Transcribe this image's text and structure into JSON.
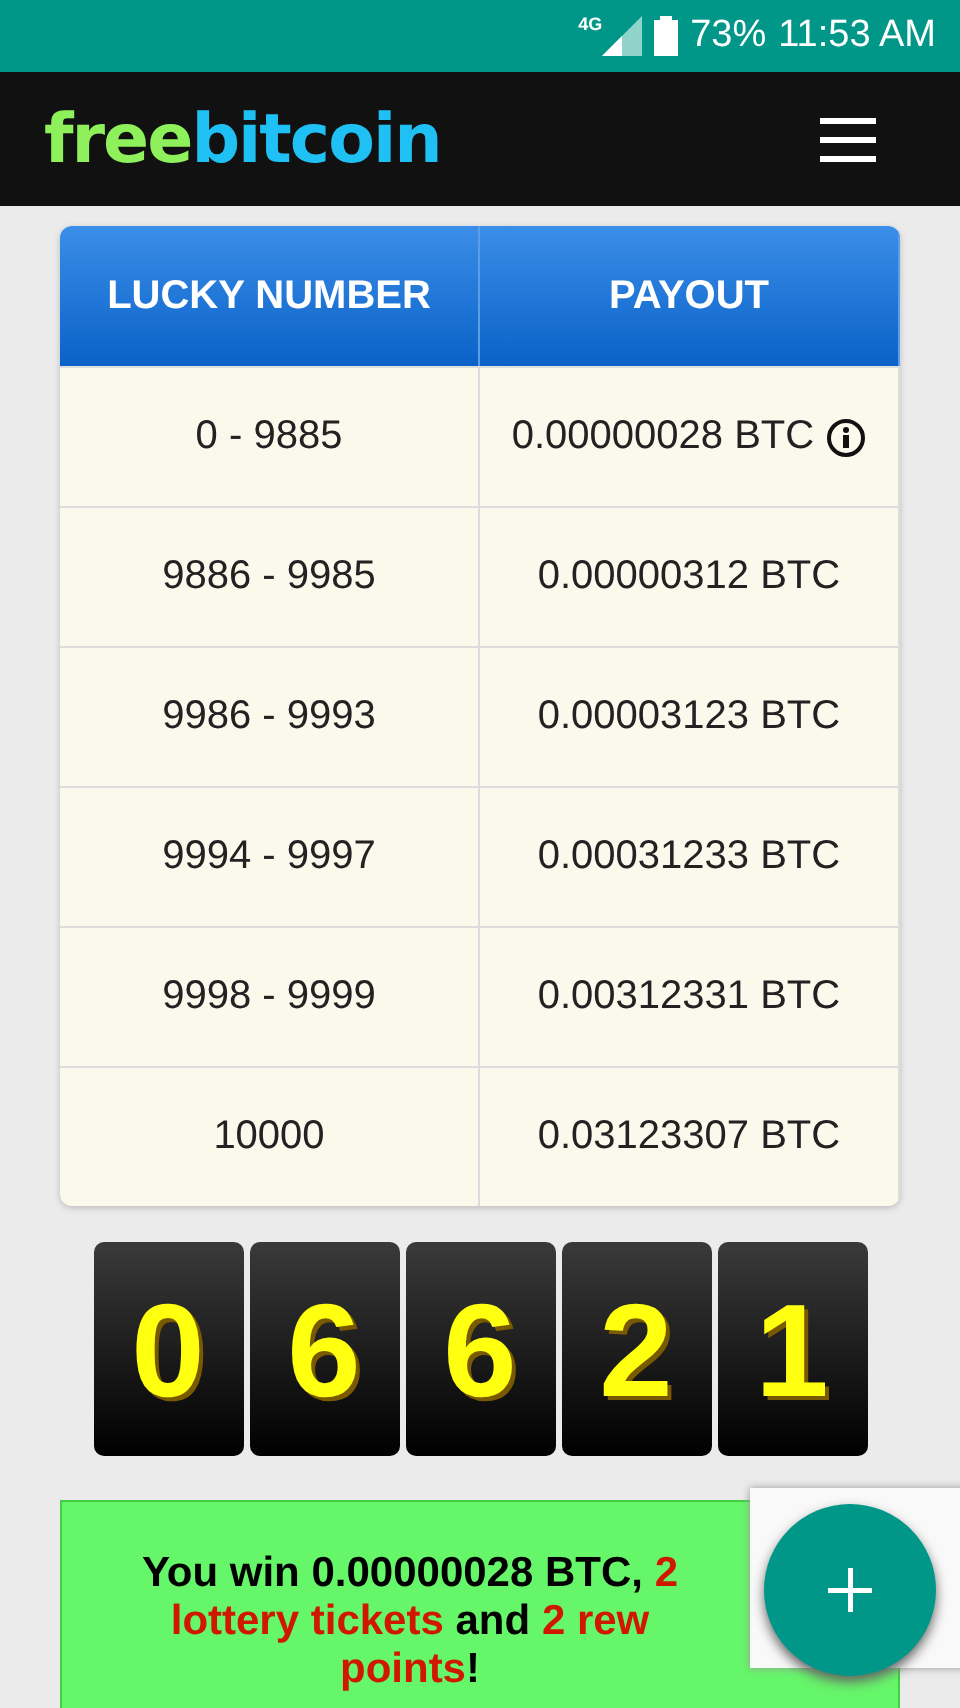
{
  "status_bar": {
    "network": "4G",
    "battery": "73%",
    "time": "11:53 AM"
  },
  "header": {
    "logo_parts": [
      {
        "text": "free",
        "kind": "green"
      },
      {
        "text": "bitcoin",
        "kind": "blue"
      }
    ]
  },
  "table": {
    "columns": [
      "LUCKY NUMBER",
      "PAYOUT"
    ],
    "rows": [
      {
        "range": "0 - 9885",
        "payout": "0.00000028 BTC",
        "info": true
      },
      {
        "range": "9886 - 9985",
        "payout": "0.00000312 BTC"
      },
      {
        "range": "9986 - 9993",
        "payout": "0.00003123 BTC"
      },
      {
        "range": "9994 - 9997",
        "payout": "0.00031233 BTC"
      },
      {
        "range": "9998 - 9999",
        "payout": "0.00312331 BTC"
      },
      {
        "range": "10000",
        "payout": "0.03123307 BTC"
      }
    ]
  },
  "digits": [
    "0",
    "6",
    "6",
    "2",
    "1"
  ],
  "message": {
    "lines": [
      [
        {
          "text": "You win 0.00000028 BTC, ",
          "highlight": false
        },
        {
          "text": "2",
          "highlight": true
        }
      ],
      [
        {
          "text": "lottery tickets",
          "highlight": true
        },
        {
          "text": " and ",
          "highlight": false
        },
        {
          "text": "2 rew",
          "highlight": true
        }
      ],
      [
        {
          "text": "points",
          "highlight": true
        },
        {
          "text": "!",
          "highlight": false
        }
      ]
    ]
  }
}
